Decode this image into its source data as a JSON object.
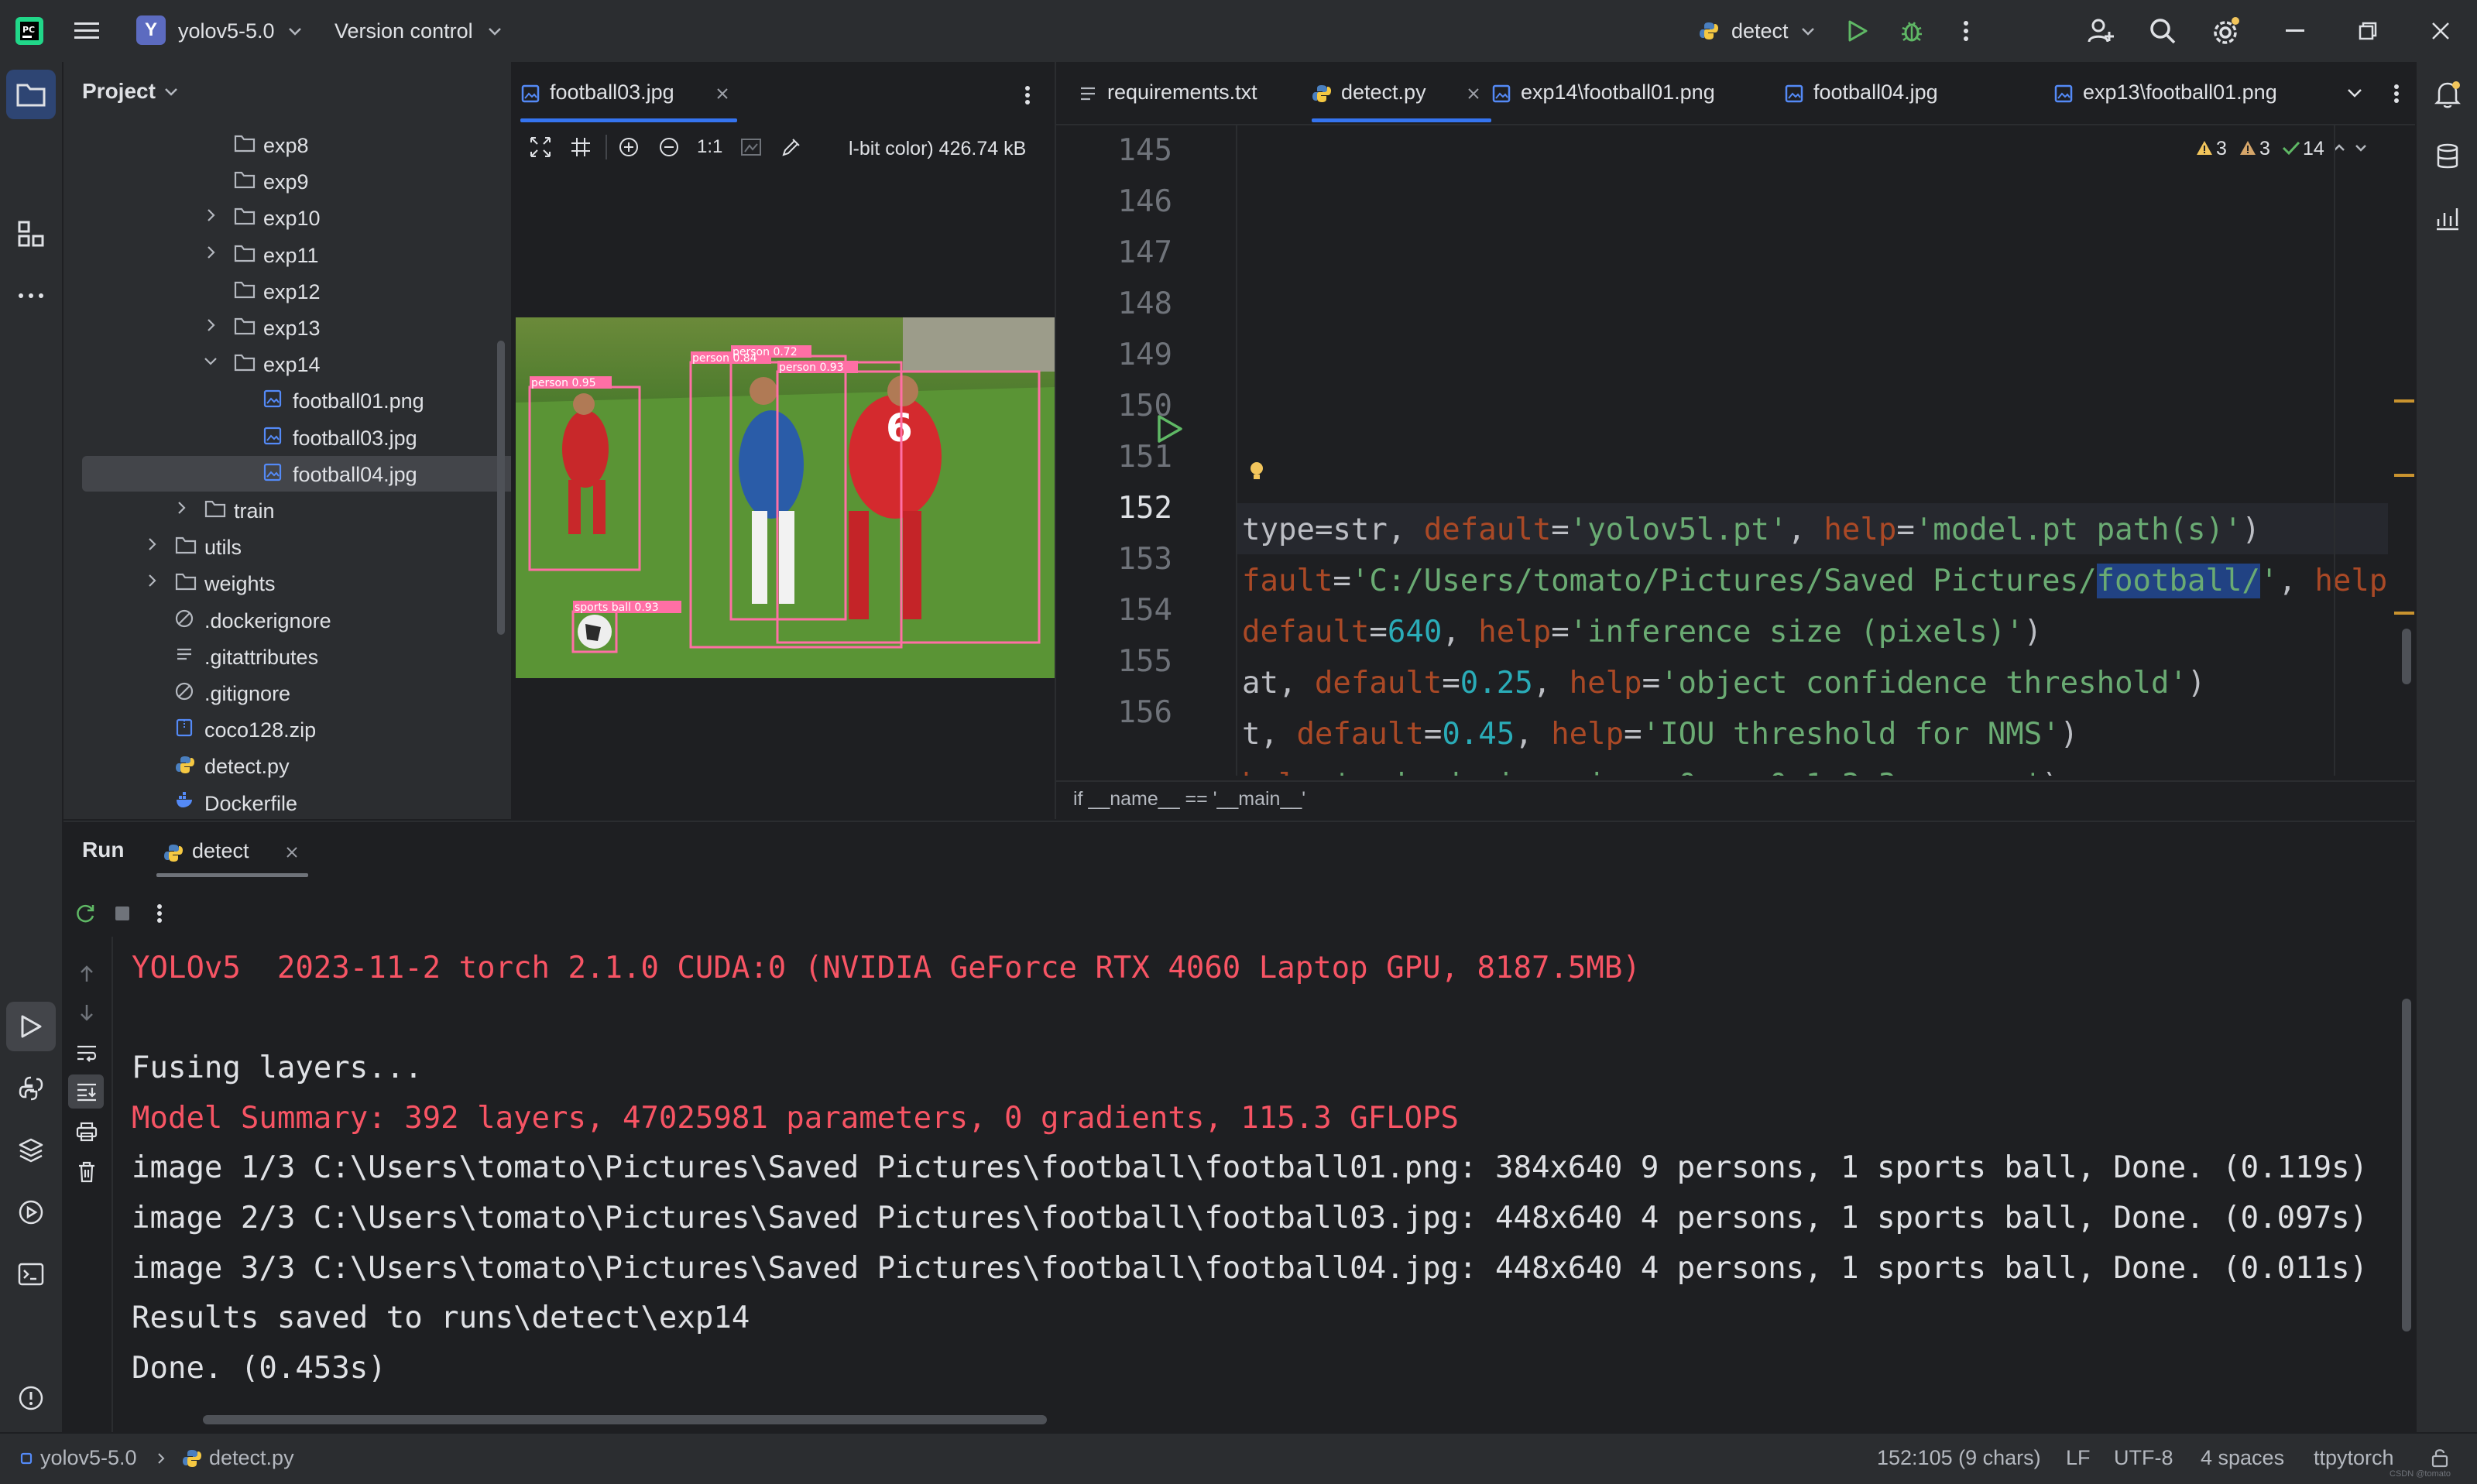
{
  "titlebar": {
    "project_badge": "Y",
    "project_name": "yolov5-5.0",
    "vcs_label": "Version control",
    "run_config": "detect"
  },
  "project_panel": {
    "title": "Project",
    "tree": [
      {
        "label": "exp8",
        "type": "folder",
        "expanded": null
      },
      {
        "label": "exp9",
        "type": "folder",
        "expanded": null
      },
      {
        "label": "exp10",
        "type": "folder",
        "expanded": false
      },
      {
        "label": "exp11",
        "type": "folder",
        "expanded": false
      },
      {
        "label": "exp12",
        "type": "folder",
        "expanded": null
      },
      {
        "label": "exp13",
        "type": "folder",
        "expanded": false
      },
      {
        "label": "exp14",
        "type": "folder",
        "expanded": true
      },
      {
        "label": "football01.png",
        "type": "image"
      },
      {
        "label": "football03.jpg",
        "type": "image"
      },
      {
        "label": "football04.jpg",
        "type": "image",
        "selected": true
      },
      {
        "label": "train",
        "type": "folder",
        "expanded": false
      },
      {
        "label": "utils",
        "type": "folder",
        "expanded": false
      },
      {
        "label": "weights",
        "type": "folder",
        "expanded": false
      },
      {
        "label": ".dockerignore",
        "type": "ignore"
      },
      {
        "label": ".gitattributes",
        "type": "text"
      },
      {
        "label": ".gitignore",
        "type": "ignore"
      },
      {
        "label": "coco128.zip",
        "type": "archive"
      },
      {
        "label": "detect.py",
        "type": "python"
      },
      {
        "label": "Dockerfile",
        "type": "docker"
      }
    ]
  },
  "image_viewer": {
    "tab_label": "football03.jpg",
    "zoom_label": "1:1",
    "info": "l-bit color) 426.74 kB",
    "detections": [
      {
        "label": "person 0.95"
      },
      {
        "label": "person 0.84"
      },
      {
        "label": "person 0.72"
      },
      {
        "label": "person 0.93"
      },
      {
        "label": "sports ball 0.93"
      }
    ]
  },
  "editor": {
    "tabs": [
      {
        "label": "requirements.txt",
        "active": false
      },
      {
        "label": "detect.py",
        "active": true
      },
      {
        "label": "exp14\\football01.png",
        "active": false
      },
      {
        "label": "football04.jpg",
        "active": false
      },
      {
        "label": "exp13\\football01.png",
        "active": false
      }
    ],
    "inspections": {
      "warnings": "3",
      "weak_warnings": "3",
      "ok": "14"
    },
    "line_numbers": [
      "145",
      "146",
      "147",
      "148",
      "149",
      "150",
      "151",
      "152",
      "153",
      "154",
      "155",
      "156"
    ],
    "breadcrumb": "if __name__ == '__main__'"
  },
  "run_panel": {
    "title": "Run",
    "tab_label": "detect",
    "lines": [
      "YOLOv5  2023-11-2 torch 2.1.0 CUDA:0 (NVIDIA GeForce RTX 4060 Laptop GPU, 8187.5MB)",
      "",
      "Fusing layers...",
      "Model Summary: 392 layers, 47025981 parameters, 0 gradients, 115.3 GFLOPS",
      "image 1/3 C:\\Users\\tomato\\Pictures\\Saved Pictures\\football\\football01.png: 384x640 9 persons, 1 sports ball, Done. (0.119s)",
      "image 2/3 C:\\Users\\tomato\\Pictures\\Saved Pictures\\football\\football03.jpg: 448x640 4 persons, 1 sports ball, Done. (0.097s)",
      "image 3/3 C:\\Users\\tomato\\Pictures\\Saved Pictures\\football\\football04.jpg: 448x640 4 persons, 1 sports ball, Done. (0.011s)",
      "Results saved to runs\\detect\\exp14",
      "Done. (0.453s)"
    ]
  },
  "statusbar": {
    "project": "yolov5-5.0",
    "file": "detect.py",
    "position": "152:105 (9 chars)",
    "line_sep": "LF",
    "encoding": "UTF-8",
    "indent": "4 spaces",
    "interpreter": "ttpytorch",
    "watermark": "CSDN @tomato"
  },
  "colors": {
    "accent": "#3574f0",
    "run_green": "#5fb865",
    "error_red": "#f75464",
    "warning_yellow": "#f2c55c"
  }
}
